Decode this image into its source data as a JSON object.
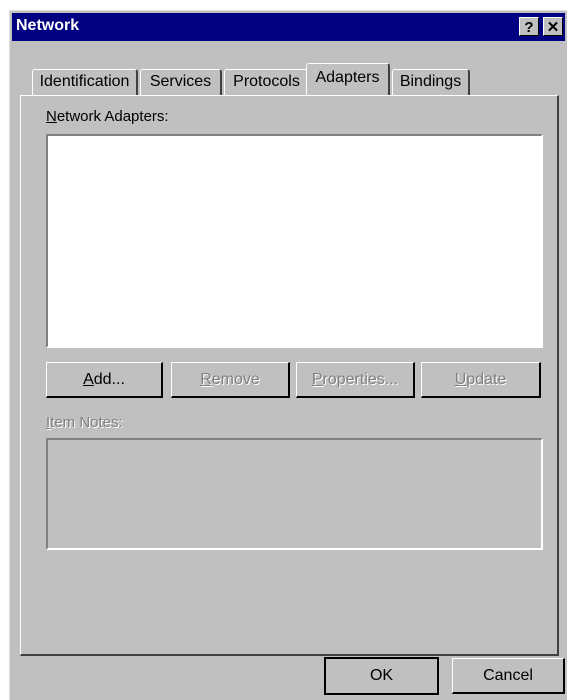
{
  "window": {
    "title": "Network",
    "help_button": "?",
    "close_button": "✕"
  },
  "tabs": [
    {
      "label": "Identification",
      "active": false
    },
    {
      "label": "Services",
      "active": false
    },
    {
      "label": "Protocols",
      "active": false
    },
    {
      "label": "Adapters",
      "active": true
    },
    {
      "label": "Bindings",
      "active": false
    }
  ],
  "adapters_panel": {
    "network_adapters_label_first": "N",
    "network_adapters_label_rest": "etwork Adapters:",
    "adapters_list": [],
    "buttons": {
      "add": {
        "mnemonic": "A",
        "rest": "dd...",
        "enabled": true
      },
      "remove": {
        "mnemonic": "R",
        "rest": "emove",
        "enabled": false
      },
      "properties": {
        "mnemonic": "P",
        "rest": "roperties...",
        "enabled": false
      },
      "update": {
        "mnemonic": "U",
        "rest": "pdate",
        "enabled": false
      }
    },
    "item_notes_label_first": "I",
    "item_notes_label_rest": "tem Notes:",
    "item_notes_text": ""
  },
  "footer": {
    "ok_label": "OK",
    "cancel_label": "Cancel"
  }
}
